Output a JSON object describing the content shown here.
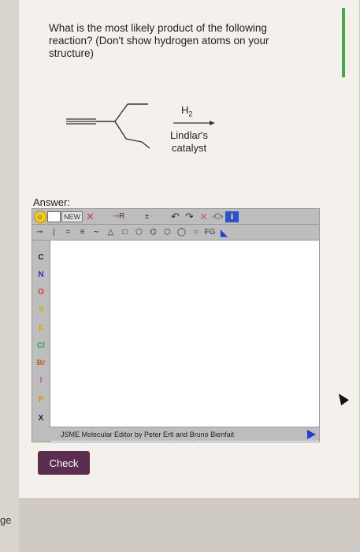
{
  "question": {
    "line1": "What is the most likely product of the following",
    "line2": "reaction? (Don't show hydrogen atoms on your",
    "line3": "structure)"
  },
  "reaction": {
    "reagent_main": "H",
    "reagent_sub": "2",
    "catalyst_line1": "Lindlar's",
    "catalyst_line2": "catalyst"
  },
  "answer_label": "Answer:",
  "editor": {
    "new_label": "NEW",
    "r_label": "R",
    "fg_label": "FG",
    "info_label": "i",
    "elements": [
      "C",
      "N",
      "O",
      "S",
      "F",
      "Cl",
      "Br",
      "I",
      "P",
      "X"
    ],
    "status": "JSME Molecular Editor by Peter Ertl and Bruno Bienfait"
  },
  "check_button": "Check",
  "side_text": "ge",
  "colors": {
    "accent_green": "#49a54a",
    "check_button_bg": "#5b2d4f",
    "info_blue": "#2a53c6"
  }
}
